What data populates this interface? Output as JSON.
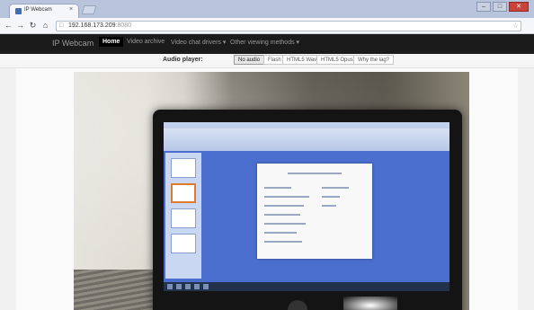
{
  "browser": {
    "tab_title": "IP Webcam",
    "tab_close": "×",
    "url_host": "192.168.173.209",
    "url_port": ":8080",
    "window_controls": [
      "–",
      "□",
      "✕"
    ],
    "nav_icons": [
      "back-icon",
      "forward-icon",
      "reload-icon",
      "home-icon"
    ]
  },
  "navbar": {
    "brand": "IP Webcam",
    "items": [
      "Home",
      "Video archive",
      "Video chat drivers ▾",
      "Other viewing methods ▾"
    ],
    "active_index": 0
  },
  "subnav": {
    "label": "Audio player:",
    "options": [
      "No audio",
      "Flash",
      "HTML5 Wav",
      "HTML5 Opus",
      "Why the lag?"
    ],
    "selected_index": 0
  },
  "colors": {
    "navbar_bg": "#1b1b1b",
    "tabstrip_bg": "#b7c4dc",
    "screen_blue": "#4a6fcf"
  }
}
